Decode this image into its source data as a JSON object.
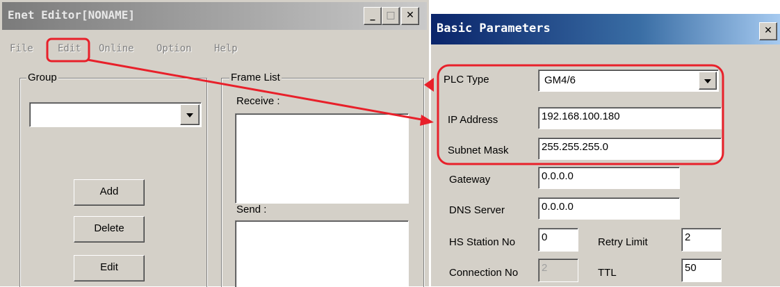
{
  "enet_window": {
    "title": "Enet Editor[NONAME]",
    "controls": {
      "minimize": "_",
      "maximize": "□",
      "close": "✕"
    },
    "menu": [
      "File",
      "Edit",
      "Online",
      "Option",
      "Help"
    ],
    "group_panel": {
      "label": "Group",
      "select_value": "",
      "buttons": {
        "add": "Add",
        "delete": "Delete",
        "edit": "Edit"
      }
    },
    "frame_list": {
      "label": "Frame List",
      "receive_label": "Receive :",
      "send_label": "Send :"
    }
  },
  "params_dialog": {
    "title": "Basic Parameters",
    "close": "✕",
    "fields": {
      "plc_type": {
        "label": "PLC Type",
        "value": "GM4/6"
      },
      "ip_address": {
        "label": "IP Address",
        "value": "192.168.100.180"
      },
      "subnet_mask": {
        "label": "Subnet Mask",
        "value": "255.255.255.0"
      },
      "gateway": {
        "label": "Gateway",
        "value": "0.0.0.0"
      },
      "dns_server": {
        "label": "DNS Server",
        "value": "0.0.0.0"
      },
      "hs_station_no": {
        "label": "HS Station No",
        "value": "0"
      },
      "retry_limit": {
        "label": "Retry Limit",
        "value": "2"
      },
      "connection_no": {
        "label": "Connection No",
        "value": "2"
      },
      "ttl": {
        "label": "TTL",
        "value": "50"
      }
    }
  },
  "annotation": {
    "color": "#e8202a"
  }
}
